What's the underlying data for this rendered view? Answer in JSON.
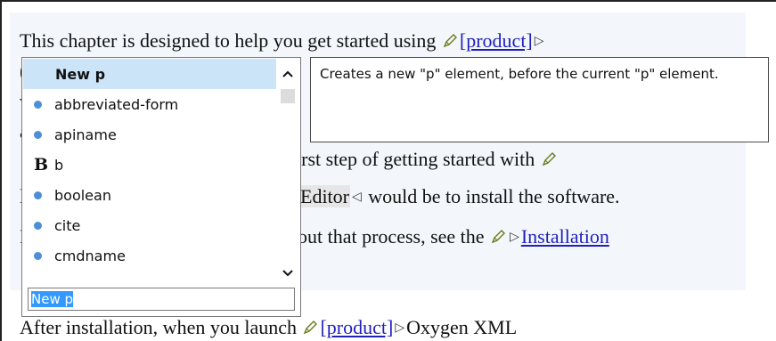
{
  "document": {
    "line1": {
      "text": "This chapter is designed to help you get started using",
      "link": "[product]"
    },
    "line3": {
      "text": "irst step of getting started with"
    },
    "line4": {
      "before": "Editor",
      "after": " would be to install the software."
    },
    "line5": {
      "text": "out that process, see the",
      "link": "Installation"
    },
    "last_line": {
      "text": "After installation, when you launch",
      "link": "[product]",
      "after": "Oxygen XML"
    },
    "stubs": [
      "(",
      "v",
      "a",
      "l",
      "I"
    ]
  },
  "completion": {
    "items": [
      {
        "label": "New p",
        "icon": "none",
        "selected": true
      },
      {
        "label": "abbreviated-form",
        "icon": "element-bullet-icon",
        "selected": false
      },
      {
        "label": "apiname",
        "icon": "element-bullet-icon",
        "selected": false
      },
      {
        "label": "b",
        "icon": "bold-icon",
        "selected": false
      },
      {
        "label": "boolean",
        "icon": "element-bullet-icon",
        "selected": false
      },
      {
        "label": "cite",
        "icon": "element-bullet-icon",
        "selected": false
      },
      {
        "label": "cmdname",
        "icon": "element-bullet-icon",
        "selected": false
      }
    ],
    "bold_icon_glyph": "B",
    "filter_value": "New p"
  },
  "tooltip": {
    "text": "Creates a new \"p\" element, before the current \"p\" element."
  },
  "colors": {
    "selection_bg": "#cce4f7",
    "bullet": "#4c8fd6",
    "link": "#1f1fbd",
    "filter_selection": "#3399ff"
  }
}
